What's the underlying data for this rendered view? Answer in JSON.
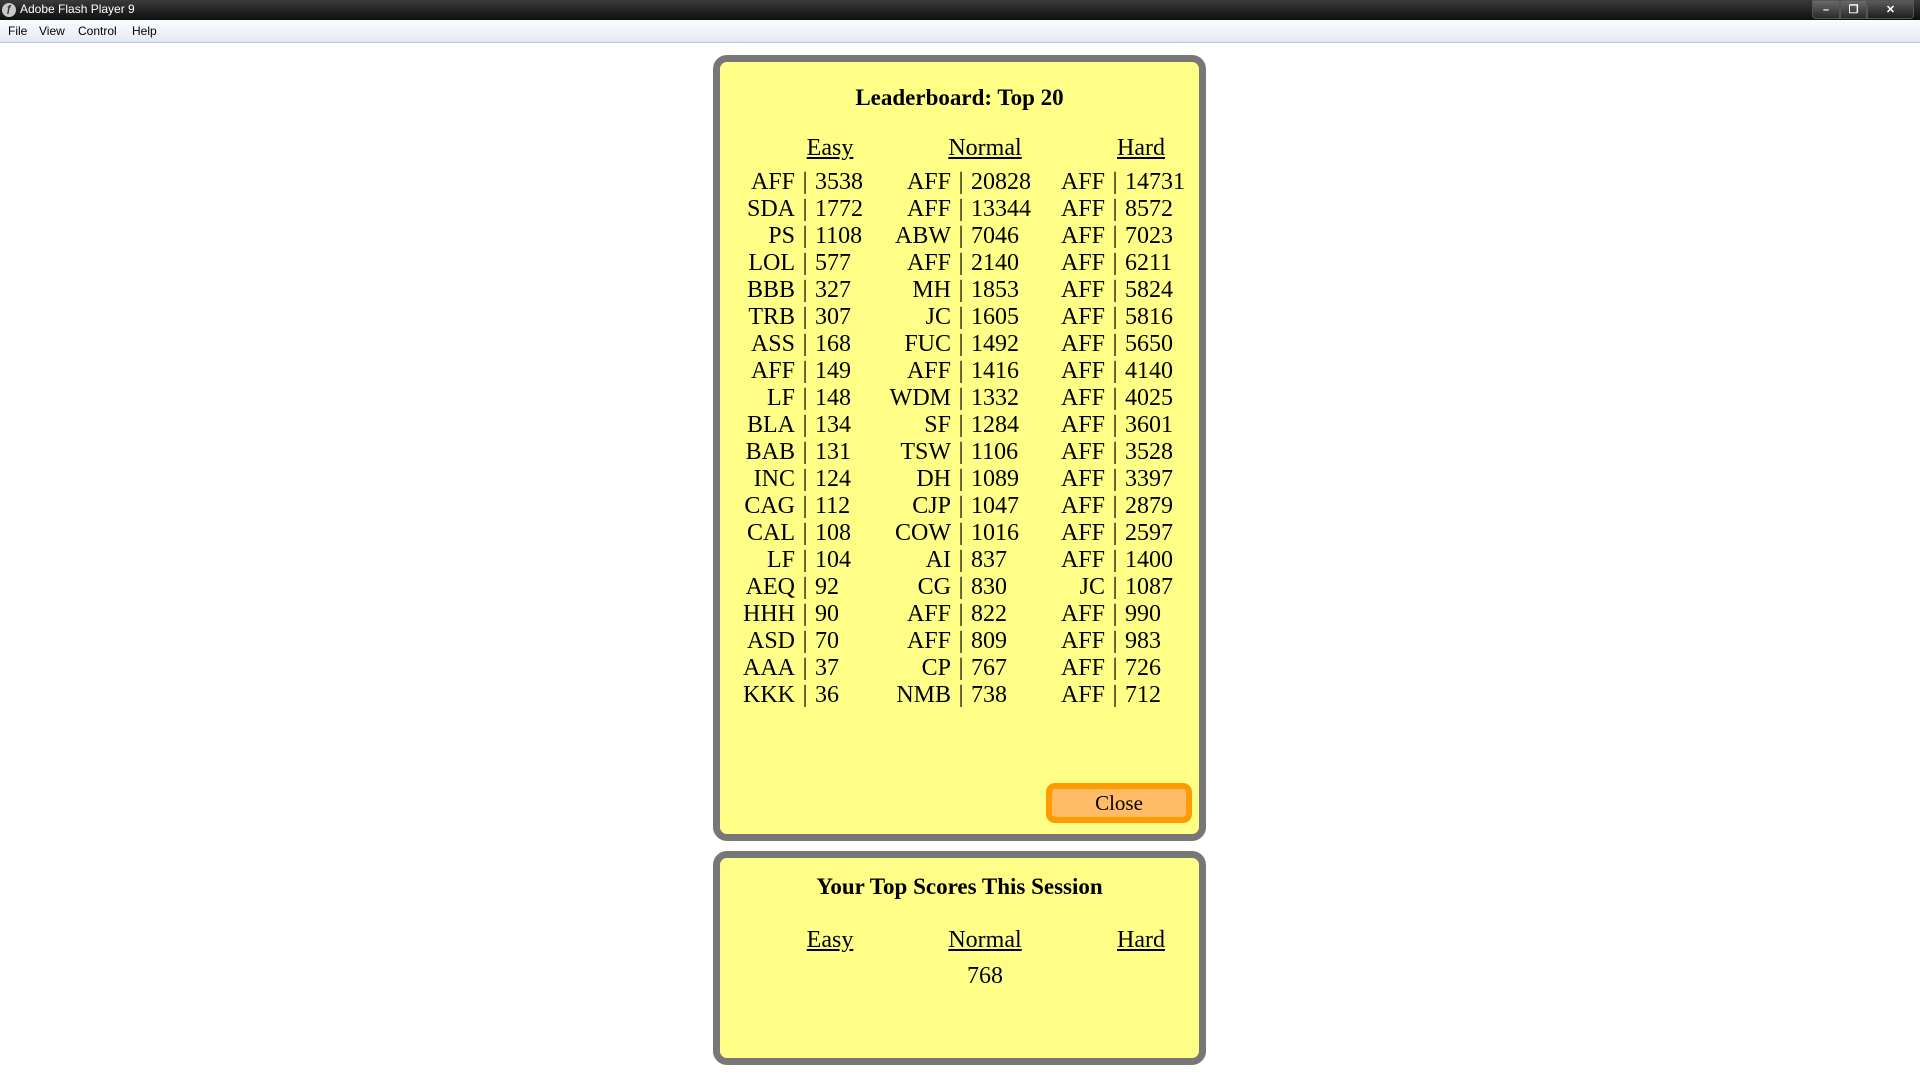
{
  "window": {
    "title": "Adobe Flash Player 9",
    "controls": {
      "minimize": "–",
      "maximize": "❐",
      "close": "✕"
    }
  },
  "menu": [
    "File",
    "View",
    "Control",
    "Help"
  ],
  "leaderboard": {
    "title": "Leaderboard: Top 20",
    "columns": {
      "easy": {
        "label": "Easy",
        "entries": [
          {
            "name": "AFF",
            "score": "3538"
          },
          {
            "name": "SDA",
            "score": "1772"
          },
          {
            "name": "PS",
            "score": "1108"
          },
          {
            "name": "LOL",
            "score": "577"
          },
          {
            "name": "BBB",
            "score": "327"
          },
          {
            "name": "TRB",
            "score": "307"
          },
          {
            "name": "ASS",
            "score": "168"
          },
          {
            "name": "AFF",
            "score": "149"
          },
          {
            "name": "LF",
            "score": "148"
          },
          {
            "name": "BLA",
            "score": "134"
          },
          {
            "name": "BAB",
            "score": "131"
          },
          {
            "name": "INC",
            "score": "124"
          },
          {
            "name": "CAG",
            "score": "112"
          },
          {
            "name": "CAL",
            "score": "108"
          },
          {
            "name": "LF",
            "score": "104"
          },
          {
            "name": "AEQ",
            "score": "92"
          },
          {
            "name": "HHH",
            "score": "90"
          },
          {
            "name": "ASD",
            "score": "70"
          },
          {
            "name": "AAA",
            "score": "37"
          },
          {
            "name": "KKK",
            "score": "36"
          }
        ]
      },
      "normal": {
        "label": "Normal",
        "entries": [
          {
            "name": "AFF",
            "score": "20828"
          },
          {
            "name": "AFF",
            "score": "13344"
          },
          {
            "name": "ABW",
            "score": "7046"
          },
          {
            "name": "AFF",
            "score": "2140"
          },
          {
            "name": "MH",
            "score": "1853"
          },
          {
            "name": "JC",
            "score": "1605"
          },
          {
            "name": "FUC",
            "score": "1492"
          },
          {
            "name": "AFF",
            "score": "1416"
          },
          {
            "name": "WDM",
            "score": "1332"
          },
          {
            "name": "SF",
            "score": "1284"
          },
          {
            "name": "TSW",
            "score": "1106"
          },
          {
            "name": "DH",
            "score": "1089"
          },
          {
            "name": "CJP",
            "score": "1047"
          },
          {
            "name": "COW",
            "score": "1016"
          },
          {
            "name": "AI",
            "score": "837"
          },
          {
            "name": "CG",
            "score": "830"
          },
          {
            "name": "AFF",
            "score": "822"
          },
          {
            "name": "AFF",
            "score": "809"
          },
          {
            "name": "CP",
            "score": "767"
          },
          {
            "name": "NMB",
            "score": "738"
          }
        ]
      },
      "hard": {
        "label": "Hard",
        "entries": [
          {
            "name": "AFF",
            "score": "14731"
          },
          {
            "name": "AFF",
            "score": "8572"
          },
          {
            "name": "AFF",
            "score": "7023"
          },
          {
            "name": "AFF",
            "score": "6211"
          },
          {
            "name": "AFF",
            "score": "5824"
          },
          {
            "name": "AFF",
            "score": "5816"
          },
          {
            "name": "AFF",
            "score": "5650"
          },
          {
            "name": "AFF",
            "score": "4140"
          },
          {
            "name": "AFF",
            "score": "4025"
          },
          {
            "name": "AFF",
            "score": "3601"
          },
          {
            "name": "AFF",
            "score": "3528"
          },
          {
            "name": "AFF",
            "score": "3397"
          },
          {
            "name": "AFF",
            "score": "2879"
          },
          {
            "name": "AFF",
            "score": "2597"
          },
          {
            "name": "AFF",
            "score": "1400"
          },
          {
            "name": "JC",
            "score": "1087"
          },
          {
            "name": "AFF",
            "score": "990"
          },
          {
            "name": "AFF",
            "score": "983"
          },
          {
            "name": "AFF",
            "score": "726"
          },
          {
            "name": "AFF",
            "score": "712"
          }
        ]
      }
    },
    "close_label": "Close"
  },
  "session": {
    "title": "Your Top Scores This Session",
    "columns": {
      "easy": {
        "label": "Easy",
        "value": ""
      },
      "normal": {
        "label": "Normal",
        "value": "768"
      },
      "hard": {
        "label": "Hard",
        "value": ""
      }
    }
  },
  "colors": {
    "panel_bg": "#ffff88",
    "panel_border": "#777777",
    "button_bg": "#ffbb66",
    "button_border": "#ff9a00"
  }
}
